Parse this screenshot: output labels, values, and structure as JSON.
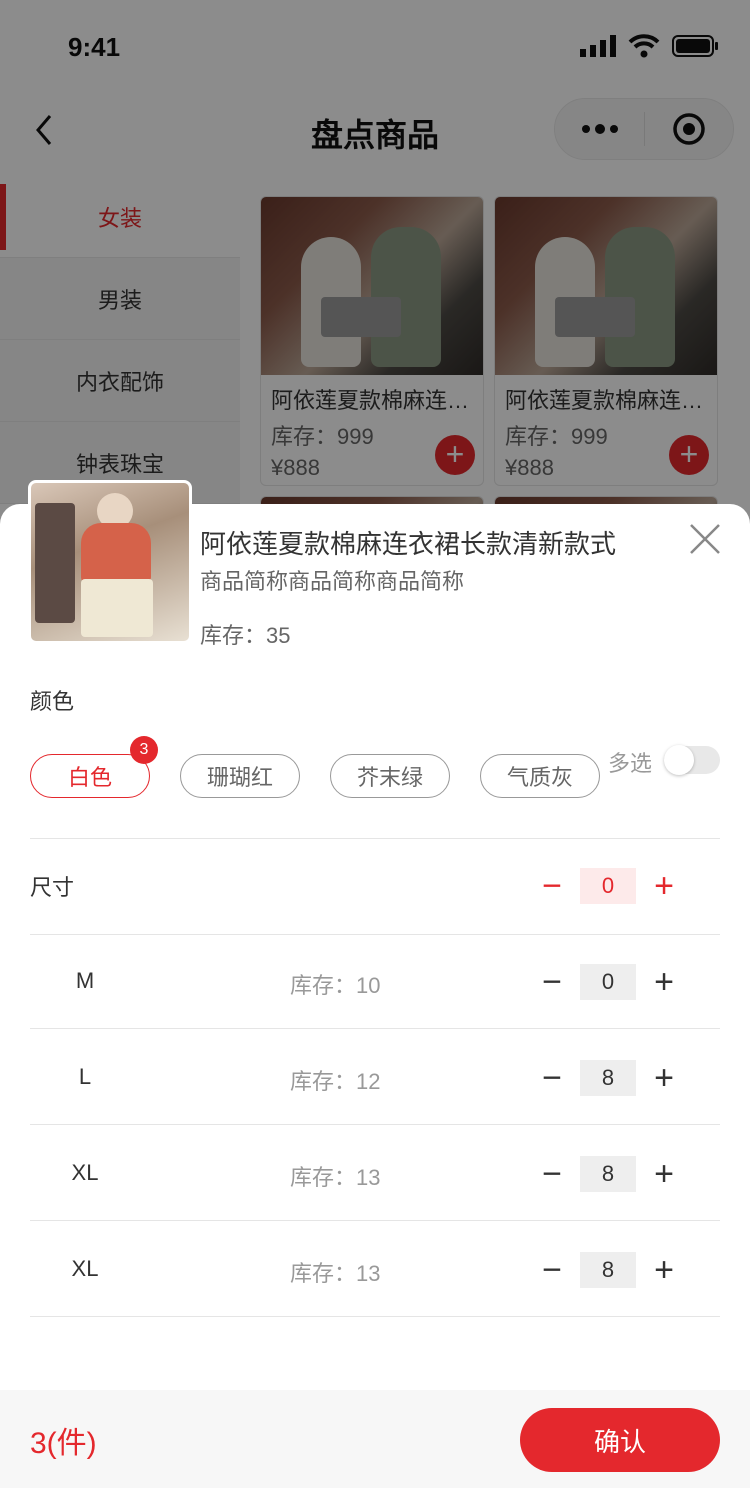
{
  "status": {
    "time": "9:41"
  },
  "nav": {
    "title": "盘点商品"
  },
  "sidebar": {
    "items": [
      {
        "label": "女装",
        "active": true
      },
      {
        "label": "男装"
      },
      {
        "label": "内衣配饰"
      },
      {
        "label": "钟表珠宝"
      }
    ]
  },
  "products": [
    {
      "title": "阿依莲夏款棉麻连衣裙长款清新",
      "stock": "库存：999",
      "price": "¥888"
    },
    {
      "title": "阿依莲夏款棉麻连衣裙长款清新",
      "stock": "库存：999",
      "price": "¥888"
    }
  ],
  "sheet": {
    "title": "阿依莲夏款棉麻连衣裙长款清新款式",
    "subtitle": "商品简称商品简称商品简称",
    "stock": "库存：35",
    "color_label": "颜色",
    "colors": [
      {
        "label": "白色",
        "active": true
      },
      {
        "label": "珊瑚红"
      },
      {
        "label": "芥末绿"
      },
      {
        "label": "气质灰"
      }
    ],
    "color_badge": "3",
    "multi_label": "多选",
    "multi_on": false,
    "size_label": "尺寸",
    "size_total": "0",
    "sizes": [
      {
        "name": "M",
        "stock": "库存：10",
        "qty": "0"
      },
      {
        "name": "L",
        "stock": "库存：12",
        "qty": "8"
      },
      {
        "name": "XL",
        "stock": "库存：13",
        "qty": "8"
      },
      {
        "name": "XL",
        "stock": "库存：13",
        "qty": "8"
      }
    ]
  },
  "footer": {
    "total": "3(件)",
    "confirm": "确认"
  },
  "glyphs": {
    "minus": "−",
    "plus": "+",
    "add": "+"
  },
  "colors_theme": {
    "accent": "#e4282d"
  }
}
